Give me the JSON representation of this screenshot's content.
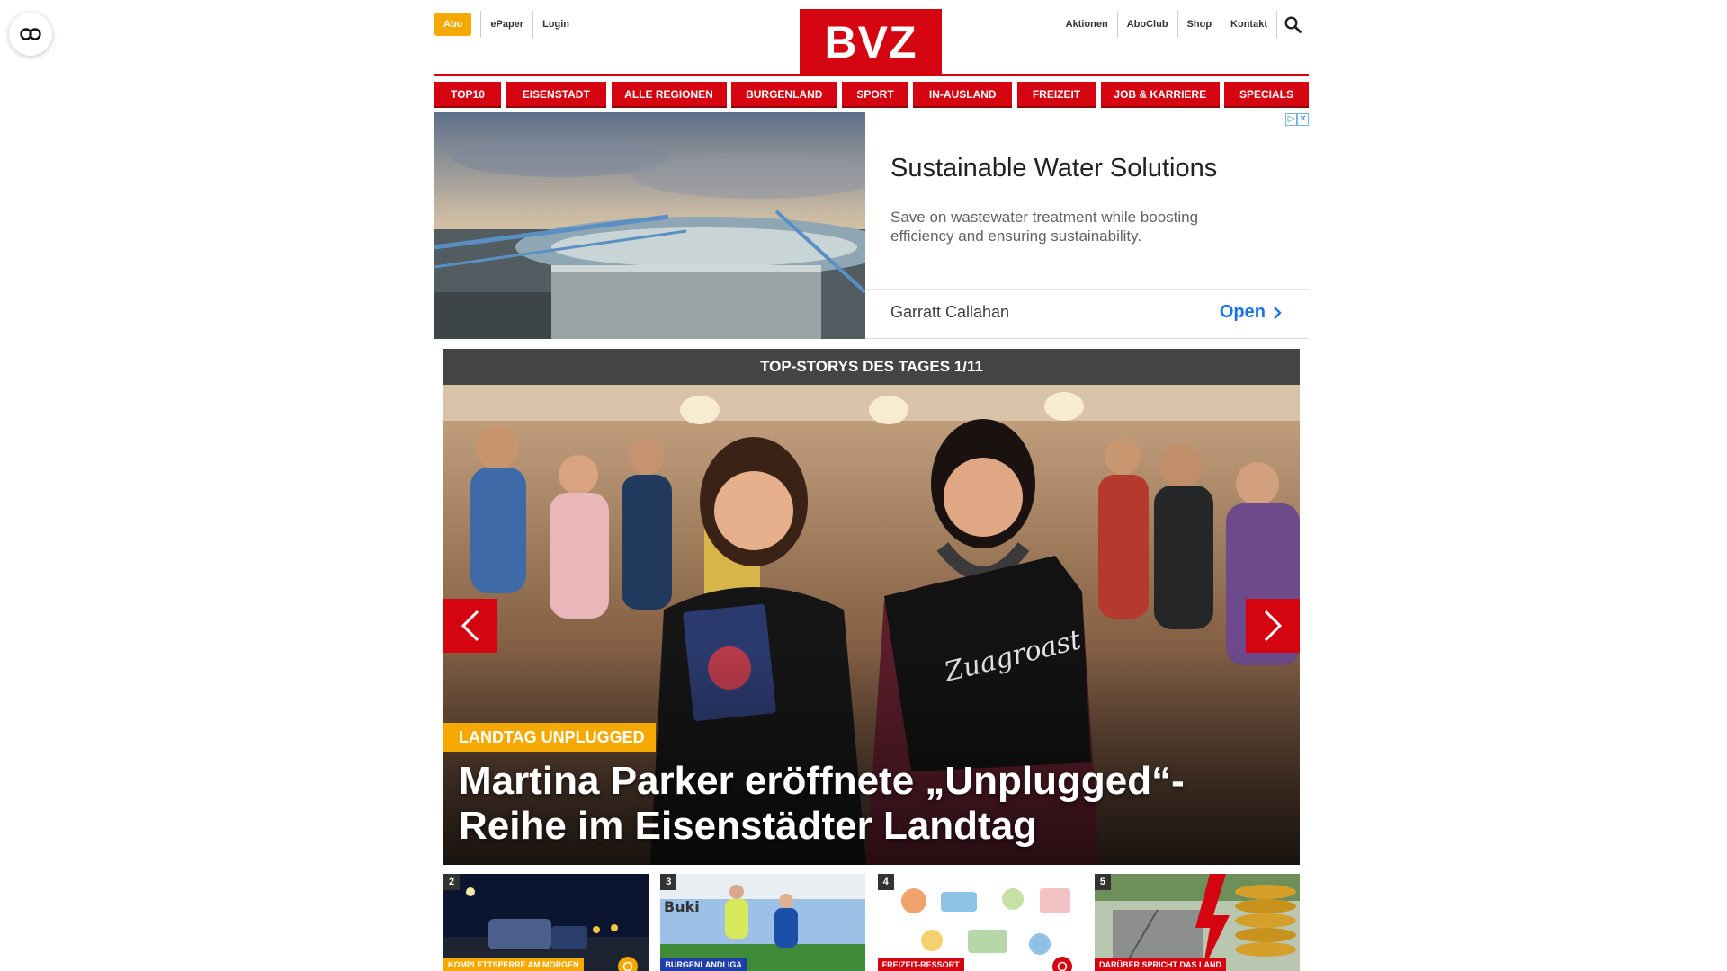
{
  "header": {
    "logo": "BVZ",
    "abo_label": "Abo",
    "left_links": [
      "ePaper",
      "Login"
    ],
    "right_links": [
      "Aktionen",
      "AboClub",
      "Shop",
      "Kontakt"
    ],
    "search_icon": "search-icon"
  },
  "nav": {
    "items": [
      "TOP10",
      "EISENSTADT",
      "ALLE REGIONEN",
      "BURGENLAND",
      "SPORT",
      "IN-AUSLAND",
      "FREIZEIT",
      "JOB & KARRIERE",
      "SPECIALS"
    ]
  },
  "ad": {
    "title": "Sustainable Water Solutions",
    "description": "Save on wastewater treatment while boosting efficiency and ensuring sustainability.",
    "advertiser": "Garratt Callahan",
    "cta": "Open"
  },
  "stories": {
    "header": "TOP-STORYS DES TAGES 1/11",
    "hero": {
      "kicker": "LANDTAG UNPLUGGED",
      "headline": "Martina Parker eröffnete „Unplugged“-Reihe im Eisenstädter Landtag"
    },
    "teasers": [
      {
        "num": "2",
        "label": "KOMPLETTSPERRE AM MORGEN",
        "color": "#f5a800"
      },
      {
        "num": "3",
        "label": "BURGENLANDLIGA",
        "color": "#1f3fa8"
      },
      {
        "num": "4",
        "label": "FREIZEIT-RESSORT",
        "color": "#d40511"
      },
      {
        "num": "5",
        "label": "DARÜBER SPRICHT DAS LAND",
        "color": "#d40511"
      }
    ]
  },
  "colors": {
    "brand_red": "#d40511",
    "abo_yellow": "#f5a800",
    "dark_header": "#444444",
    "ad_link": "#1a73e8"
  }
}
